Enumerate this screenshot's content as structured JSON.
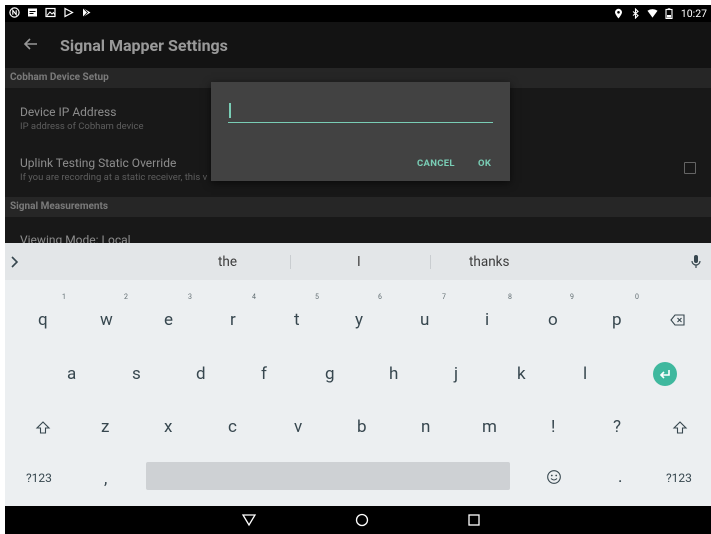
{
  "status_bar": {
    "left_icons": [
      "notification-n-icon",
      "message-icon",
      "photo-icon",
      "media-icon",
      "play-store-icon"
    ],
    "right_icons": [
      "location-icon",
      "bluetooth-icon",
      "wifi-icon",
      "battery-icon"
    ],
    "time": "10:27"
  },
  "app_bar": {
    "title": "Signal Mapper Settings"
  },
  "sections": {
    "device_setup": "Cobham Device Setup",
    "measurements": "Signal Measurements"
  },
  "prefs": {
    "ip": {
      "title": "Device IP Address",
      "summary": "IP address of Cobham device"
    },
    "uplink": {
      "title": "Uplink Testing Static Override",
      "summary": "If you are recording at a static receiver, this v"
    },
    "viewing": {
      "title": "Viewing Mode: Local"
    }
  },
  "dialog": {
    "value": "",
    "cancel": "CANCEL",
    "ok": "OK"
  },
  "keyboard": {
    "suggestions": [
      "the",
      "I",
      "thanks"
    ],
    "row1": [
      "q",
      "w",
      "e",
      "r",
      "t",
      "y",
      "u",
      "i",
      "o",
      "p"
    ],
    "row1_hints": [
      "1",
      "2",
      "3",
      "4",
      "5",
      "6",
      "7",
      "8",
      "9",
      "0"
    ],
    "row2": [
      "a",
      "s",
      "d",
      "f",
      "g",
      "h",
      "j",
      "k",
      "l"
    ],
    "row3": [
      "z",
      "x",
      "c",
      "v",
      "b",
      "n",
      "m",
      "!",
      "?"
    ],
    "sym_left": "?123",
    "sym_right": "?123",
    "comma": ",",
    "period": "."
  },
  "colors": {
    "accent": "#79cdb5",
    "enter": "#3fb89e",
    "keyboard_bg": "#eceff1"
  }
}
